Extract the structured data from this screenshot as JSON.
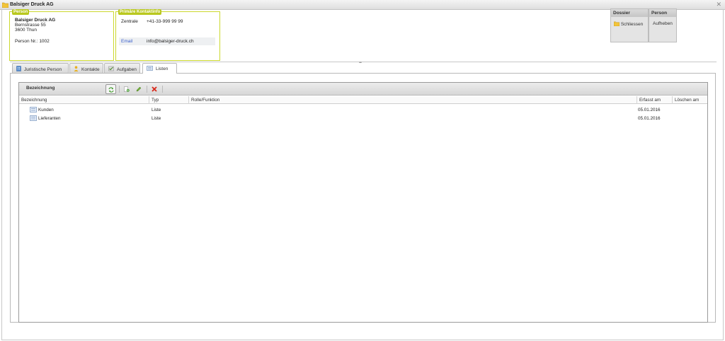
{
  "window": {
    "title": "Balsiger Druck AG"
  },
  "person_box": {
    "legend": "Person",
    "name": "Balsiger Druck AG",
    "street": "Bernstrasse 55",
    "city": "3600 Thun",
    "person_nr": "Person Nr.: 1002"
  },
  "contact_box": {
    "legend": "Primäre Kontaktinfo",
    "phone_label": "Zentrale",
    "phone_value": "+41-33-999 99 99",
    "email_label": "Email",
    "email_value": "info@balsiger-druck.ch"
  },
  "actions": {
    "dossier_header": "Dossier",
    "dossier_button": "Schliessen",
    "person_header": "Person",
    "person_button": "Aufheben"
  },
  "tabs": [
    {
      "label": "Juristische Person"
    },
    {
      "label": "Kontakte"
    },
    {
      "label": "Aufgaben"
    },
    {
      "label": "Listen"
    }
  ],
  "grid": {
    "title": "Bezeichnung",
    "columns": [
      "Bezeichnung",
      "Typ",
      "Rolle/Funktion",
      "Erfasst am",
      "Löschen am"
    ],
    "rows": [
      {
        "name": "Kunden",
        "typ": "Liste",
        "rolle": "",
        "erfasst": "05.01.2016",
        "loeschen": ""
      },
      {
        "name": "Lieferanten",
        "typ": "Liste",
        "rolle": "",
        "erfasst": "05.01.2016",
        "loeschen": ""
      }
    ]
  },
  "colors": {
    "accent_green": "#b9c81e",
    "email_link": "#3a5fcd"
  },
  "icons": {
    "title": "folder-icon",
    "close": "close-icon",
    "tab0": "building-icon",
    "tab1": "person-icon",
    "tab2": "tasks-icon",
    "tab3": "list-icon",
    "refresh": "refresh-icon",
    "add": "add-document-icon",
    "edit": "pencil-icon",
    "delete": "delete-icon",
    "row": "list-icon"
  }
}
